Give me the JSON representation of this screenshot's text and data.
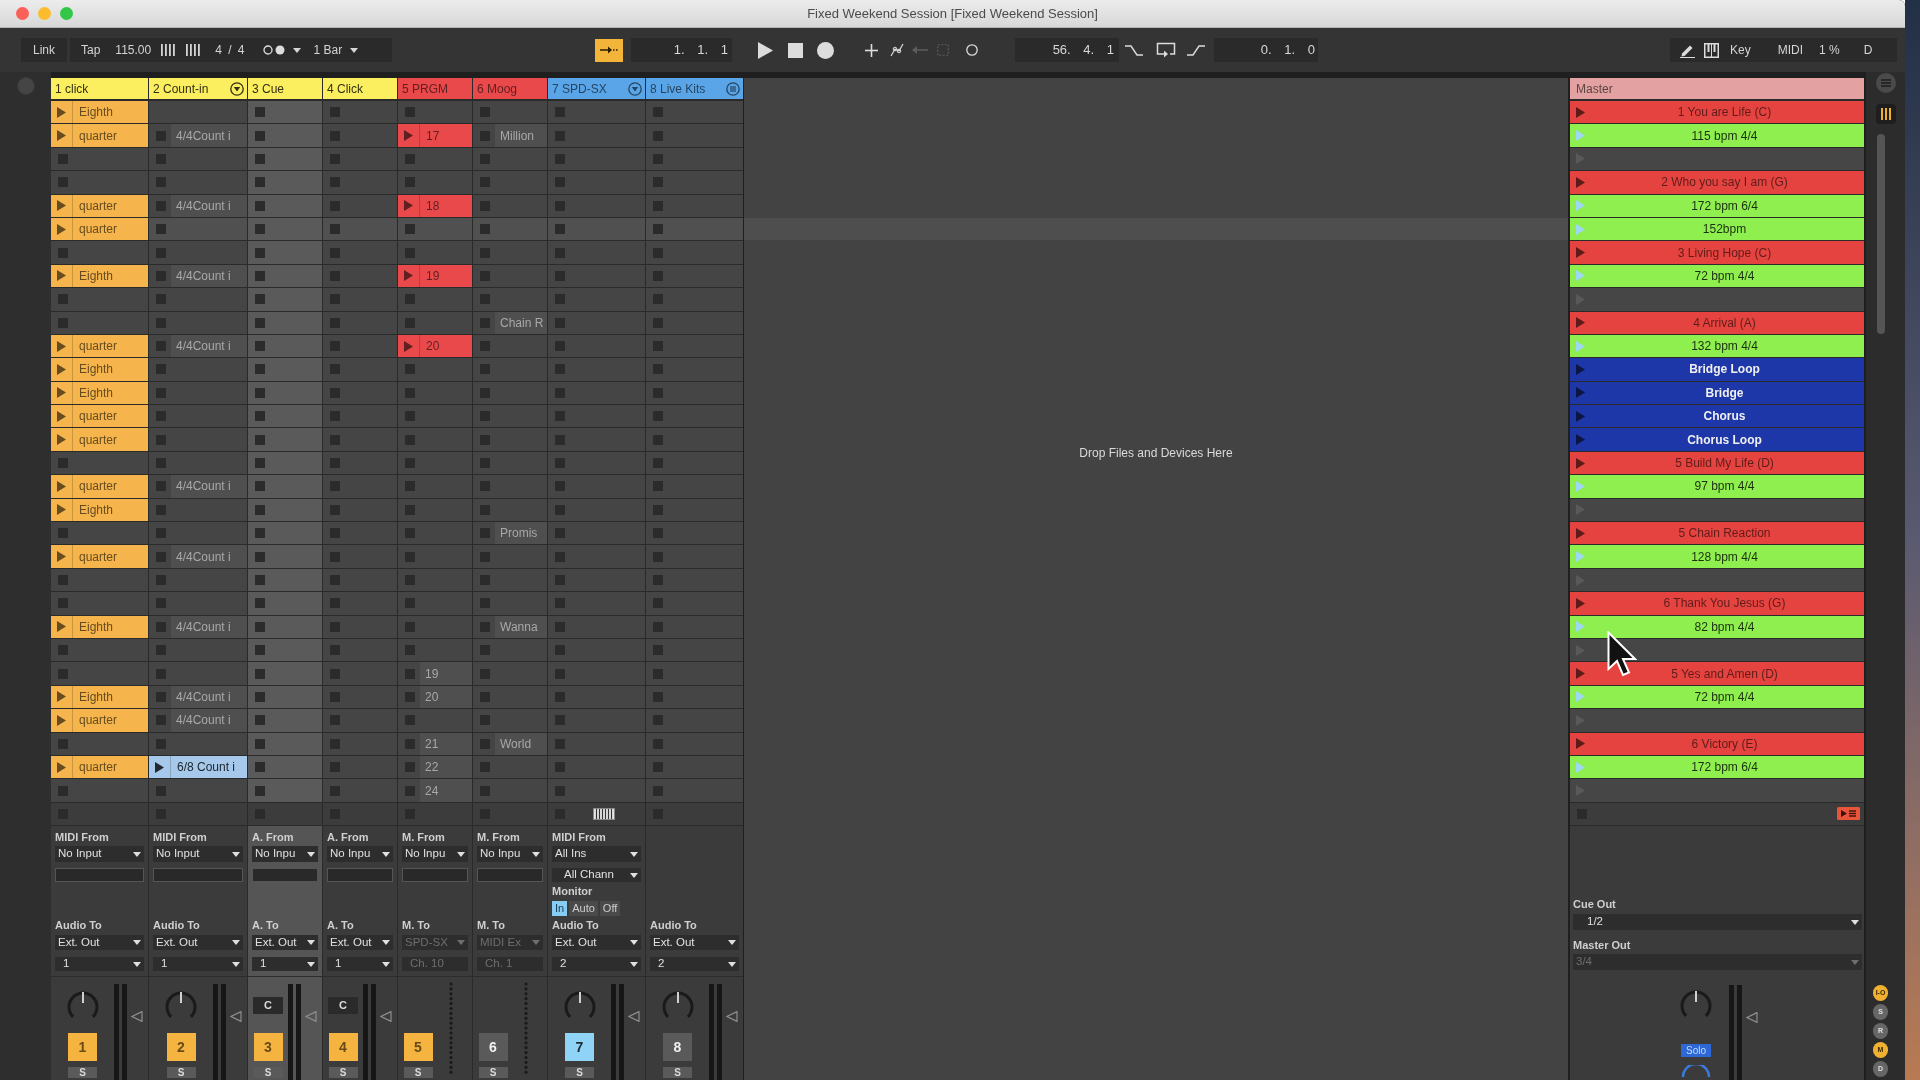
{
  "window": {
    "title": "Fixed Weekend Session [Fixed Weekend Session]"
  },
  "toolbar": {
    "link": "Link",
    "tap": "Tap",
    "tempo": "115.00",
    "signature": "4 / 4",
    "quantization": "1 Bar",
    "follow": {
      "on": true
    },
    "position": "1. 1. 1",
    "loop_start": "56. 4. 1",
    "loop_length": "0. 1. 0",
    "key": "Key",
    "midi": "MIDI",
    "cpu": "1 %",
    "disk": "D"
  },
  "tracks": [
    {
      "name": "1 click",
      "color": "#fbee5f",
      "kind": "plain",
      "selected": false,
      "keys": false,
      "slots": [
        {
          "kind": "clip",
          "name": "Eighth",
          "color": "#f5b54c"
        },
        {
          "kind": "clip",
          "name": "quarter",
          "color": "#f5b54c"
        },
        {
          "kind": "empty"
        },
        {
          "kind": "empty"
        },
        {
          "kind": "clip",
          "name": "quarter",
          "color": "#f5b54c"
        },
        {
          "kind": "clip",
          "name": "quarter",
          "color": "#f5b54c"
        },
        {
          "kind": "empty"
        },
        {
          "kind": "clip",
          "name": "Eighth",
          "color": "#f5b54c"
        },
        {
          "kind": "empty"
        },
        {
          "kind": "empty"
        },
        {
          "kind": "clip",
          "name": "quarter",
          "color": "#f5b54c"
        },
        {
          "kind": "clip",
          "name": "Eighth",
          "color": "#f5b54c"
        },
        {
          "kind": "clip",
          "name": "Eighth",
          "color": "#f5b54c"
        },
        {
          "kind": "clip",
          "name": "quarter",
          "color": "#f5b54c"
        },
        {
          "kind": "clip",
          "name": "quarter",
          "color": "#f5b54c"
        },
        {
          "kind": "empty"
        },
        {
          "kind": "clip",
          "name": "quarter",
          "color": "#f5b54c"
        },
        {
          "kind": "clip",
          "name": "Eighth",
          "color": "#f5b54c"
        },
        {
          "kind": "empty"
        },
        {
          "kind": "clip",
          "name": "quarter",
          "color": "#f5b54c"
        },
        {
          "kind": "empty"
        },
        {
          "kind": "empty"
        },
        {
          "kind": "clip",
          "name": "Eighth",
          "color": "#f5b54c"
        },
        {
          "kind": "empty"
        },
        {
          "kind": "empty"
        },
        {
          "kind": "clip",
          "name": "Eighth",
          "color": "#f5b54c"
        },
        {
          "kind": "clip",
          "name": "quarter",
          "color": "#f5b54c"
        },
        {
          "kind": "empty"
        },
        {
          "kind": "clip",
          "name": "quarter",
          "color": "#f5b54c"
        },
        {
          "kind": "empty"
        }
      ],
      "mixer": {
        "kind": "knob",
        "input_label": "MIDI From",
        "input": "No Input",
        "output_label": "Audio To",
        "output": "Ext. Out",
        "output_disabled": false,
        "channel": "1",
        "activator": {
          "label": "1",
          "color": "#f5b43f"
        },
        "solo": "S"
      }
    },
    {
      "name": "2 Count-in",
      "color": "#fbee5f",
      "kind": "group",
      "selected": false,
      "keys": false,
      "slots": [
        {
          "kind": "blank"
        },
        {
          "kind": "dim",
          "name": "4/4Count i"
        },
        {
          "kind": "empty"
        },
        {
          "kind": "empty"
        },
        {
          "kind": "dim",
          "name": "4/4Count i"
        },
        {
          "kind": "empty"
        },
        {
          "kind": "empty"
        },
        {
          "kind": "dim",
          "name": "4/4Count i"
        },
        {
          "kind": "empty"
        },
        {
          "kind": "empty"
        },
        {
          "kind": "dim",
          "name": "4/4Count i"
        },
        {
          "kind": "empty"
        },
        {
          "kind": "empty"
        },
        {
          "kind": "empty"
        },
        {
          "kind": "empty"
        },
        {
          "kind": "empty"
        },
        {
          "kind": "dim",
          "name": "4/4Count i"
        },
        {
          "kind": "empty"
        },
        {
          "kind": "empty"
        },
        {
          "kind": "dim",
          "name": "4/4Count i"
        },
        {
          "kind": "empty"
        },
        {
          "kind": "empty"
        },
        {
          "kind": "dim",
          "name": "4/4Count i"
        },
        {
          "kind": "empty"
        },
        {
          "kind": "empty"
        },
        {
          "kind": "dim",
          "name": "4/4Count i"
        },
        {
          "kind": "dim",
          "name": "4/4Count i"
        },
        {
          "kind": "empty"
        },
        {
          "kind": "clip",
          "name": "6/8 Count i",
          "color": "#a6c8ea"
        },
        {
          "kind": "empty"
        }
      ],
      "mixer": {
        "kind": "knob",
        "input_label": "MIDI From",
        "input": "No Input",
        "output_label": "Audio To",
        "output": "Ext. Out",
        "output_disabled": false,
        "channel": "1",
        "activator": {
          "label": "2",
          "color": "#f5b43f"
        },
        "solo": "S"
      }
    },
    {
      "name": "3 Cue",
      "color": "#fbee5f",
      "kind": "plain",
      "selected": true,
      "keys": false,
      "slots": [
        {
          "kind": "empty"
        },
        {
          "kind": "empty"
        },
        {
          "kind": "empty"
        },
        {
          "kind": "empty"
        },
        {
          "kind": "empty"
        },
        {
          "kind": "empty"
        },
        {
          "kind": "empty"
        },
        {
          "kind": "empty"
        },
        {
          "kind": "empty"
        },
        {
          "kind": "empty"
        },
        {
          "kind": "empty"
        },
        {
          "kind": "empty"
        },
        {
          "kind": "empty"
        },
        {
          "kind": "empty"
        },
        {
          "kind": "empty"
        },
        {
          "kind": "empty"
        },
        {
          "kind": "empty"
        },
        {
          "kind": "empty"
        },
        {
          "kind": "empty"
        },
        {
          "kind": "empty"
        },
        {
          "kind": "empty"
        },
        {
          "kind": "empty"
        },
        {
          "kind": "empty"
        },
        {
          "kind": "empty"
        },
        {
          "kind": "empty"
        },
        {
          "kind": "empty"
        },
        {
          "kind": "empty"
        },
        {
          "kind": "empty"
        },
        {
          "kind": "empty"
        },
        {
          "kind": "empty"
        }
      ],
      "mixer": {
        "kind": "cue",
        "control_label": "C",
        "input_label": "A. From",
        "input": "No Inpu",
        "output_label": "A. To",
        "output": "Ext. Out",
        "output_disabled": false,
        "channel": "1",
        "activator": {
          "label": "3",
          "color": "#f5b43f"
        },
        "solo": "S"
      }
    },
    {
      "name": "4 Click",
      "color": "#fbee5f",
      "kind": "plain",
      "selected": false,
      "keys": false,
      "slots": [
        {
          "kind": "empty"
        },
        {
          "kind": "empty"
        },
        {
          "kind": "empty"
        },
        {
          "kind": "empty"
        },
        {
          "kind": "empty"
        },
        {
          "kind": "empty"
        },
        {
          "kind": "empty"
        },
        {
          "kind": "empty"
        },
        {
          "kind": "empty"
        },
        {
          "kind": "empty"
        },
        {
          "kind": "empty"
        },
        {
          "kind": "empty"
        },
        {
          "kind": "empty"
        },
        {
          "kind": "empty"
        },
        {
          "kind": "empty"
        },
        {
          "kind": "empty"
        },
        {
          "kind": "empty"
        },
        {
          "kind": "empty"
        },
        {
          "kind": "empty"
        },
        {
          "kind": "empty"
        },
        {
          "kind": "empty"
        },
        {
          "kind": "empty"
        },
        {
          "kind": "empty"
        },
        {
          "kind": "empty"
        },
        {
          "kind": "empty"
        },
        {
          "kind": "empty"
        },
        {
          "kind": "empty"
        },
        {
          "kind": "empty"
        },
        {
          "kind": "empty"
        },
        {
          "kind": "empty"
        }
      ],
      "mixer": {
        "kind": "cue",
        "control_label": "C",
        "input_label": "A. From",
        "input": "No Inpu",
        "output_label": "A. To",
        "output": "Ext. Out",
        "output_disabled": false,
        "channel": "1",
        "activator": {
          "label": "4",
          "color": "#f5b43f"
        },
        "solo": "S"
      }
    },
    {
      "name": "5 PRGM",
      "color": "#e9494b",
      "kind": "plain",
      "selected": false,
      "keys": false,
      "slots": [
        {
          "kind": "empty"
        },
        {
          "kind": "clip",
          "name": "17",
          "color": "#e9494b"
        },
        {
          "kind": "empty"
        },
        {
          "kind": "empty"
        },
        {
          "kind": "clip",
          "name": "18",
          "color": "#e9494b"
        },
        {
          "kind": "empty"
        },
        {
          "kind": "empty"
        },
        {
          "kind": "clip",
          "name": "19",
          "color": "#e9494b"
        },
        {
          "kind": "empty"
        },
        {
          "kind": "empty"
        },
        {
          "kind": "clip",
          "name": "20",
          "color": "#e9494b"
        },
        {
          "kind": "empty"
        },
        {
          "kind": "empty"
        },
        {
          "kind": "empty"
        },
        {
          "kind": "empty"
        },
        {
          "kind": "empty"
        },
        {
          "kind": "empty"
        },
        {
          "kind": "empty"
        },
        {
          "kind": "empty"
        },
        {
          "kind": "empty"
        },
        {
          "kind": "empty"
        },
        {
          "kind": "empty"
        },
        {
          "kind": "empty"
        },
        {
          "kind": "empty"
        },
        {
          "kind": "dim",
          "name": "19"
        },
        {
          "kind": "dim",
          "name": "20"
        },
        {
          "kind": "empty"
        },
        {
          "kind": "dim",
          "name": "21"
        },
        {
          "kind": "dim",
          "name": "22"
        },
        {
          "kind": "dim",
          "name": "24"
        }
      ],
      "mixer": {
        "kind": "midi",
        "input_label": "M. From",
        "input": "No Inpu",
        "output_label": "M. To",
        "output": "SPD-SX",
        "output_disabled": true,
        "channel": "Ch. 10",
        "activator": {
          "label": "5",
          "color": "#f5b43f"
        },
        "solo": "S"
      }
    },
    {
      "name": "6 Moog",
      "color": "#e9494b",
      "kind": "plain",
      "selected": false,
      "keys": false,
      "slots": [
        {
          "kind": "empty"
        },
        {
          "kind": "dim",
          "name": "Million"
        },
        {
          "kind": "empty"
        },
        {
          "kind": "empty"
        },
        {
          "kind": "empty"
        },
        {
          "kind": "empty"
        },
        {
          "kind": "empty"
        },
        {
          "kind": "empty"
        },
        {
          "kind": "empty"
        },
        {
          "kind": "dim",
          "name": "Chain R"
        },
        {
          "kind": "empty"
        },
        {
          "kind": "empty"
        },
        {
          "kind": "empty"
        },
        {
          "kind": "empty"
        },
        {
          "kind": "empty"
        },
        {
          "kind": "empty"
        },
        {
          "kind": "empty"
        },
        {
          "kind": "empty"
        },
        {
          "kind": "dim",
          "name": "Promis"
        },
        {
          "kind": "empty"
        },
        {
          "kind": "empty"
        },
        {
          "kind": "empty"
        },
        {
          "kind": "dim",
          "name": "Wanna"
        },
        {
          "kind": "empty"
        },
        {
          "kind": "empty"
        },
        {
          "kind": "empty"
        },
        {
          "kind": "empty"
        },
        {
          "kind": "dim",
          "name": "World"
        },
        {
          "kind": "empty"
        },
        {
          "kind": "empty"
        }
      ],
      "mixer": {
        "kind": "midi",
        "input_label": "M. From",
        "input": "No Inpu",
        "output_label": "M. To",
        "output": "MIDI Ex",
        "output_disabled": true,
        "channel": "Ch. 1",
        "activator": {
          "label": "6",
          "color": "#5a5a5a"
        },
        "solo": "S"
      }
    },
    {
      "name": "7 SPD-SX",
      "color": "#5aa5e8",
      "kind": "group",
      "selected": false,
      "keys": true,
      "slots": [
        {
          "kind": "empty"
        },
        {
          "kind": "empty"
        },
        {
          "kind": "empty"
        },
        {
          "kind": "empty"
        },
        {
          "kind": "empty"
        },
        {
          "kind": "empty"
        },
        {
          "kind": "empty"
        },
        {
          "kind": "empty"
        },
        {
          "kind": "empty"
        },
        {
          "kind": "empty"
        },
        {
          "kind": "empty"
        },
        {
          "kind": "empty"
        },
        {
          "kind": "empty"
        },
        {
          "kind": "empty"
        },
        {
          "kind": "empty"
        },
        {
          "kind": "empty"
        },
        {
          "kind": "empty"
        },
        {
          "kind": "empty"
        },
        {
          "kind": "empty"
        },
        {
          "kind": "empty"
        },
        {
          "kind": "empty"
        },
        {
          "kind": "empty"
        },
        {
          "kind": "empty"
        },
        {
          "kind": "empty"
        },
        {
          "kind": "empty"
        },
        {
          "kind": "empty"
        },
        {
          "kind": "empty"
        },
        {
          "kind": "empty"
        },
        {
          "kind": "empty"
        },
        {
          "kind": "empty"
        }
      ],
      "mixer": {
        "kind": "knob",
        "input_label": "MIDI From",
        "input": "All Ins",
        "input_channel": "All Chann",
        "monitor": {
          "label": "Monitor",
          "options": [
            {
              "label": "In",
              "selected": true
            },
            {
              "label": "Auto",
              "selected": false
            },
            {
              "label": "Off",
              "selected": false
            }
          ]
        },
        "output_label": "Audio To",
        "output": "Ext. Out",
        "output_disabled": false,
        "channel": "2",
        "activator": {
          "label": "7",
          "color": "#8fd3f7"
        },
        "solo": "S"
      }
    },
    {
      "name": "8 Live Kits",
      "color": "#5aa5e8",
      "kind": "menu",
      "selected": false,
      "keys": false,
      "slots": [
        {
          "kind": "empty"
        },
        {
          "kind": "empty"
        },
        {
          "kind": "empty"
        },
        {
          "kind": "empty"
        },
        {
          "kind": "empty"
        },
        {
          "kind": "empty"
        },
        {
          "kind": "empty"
        },
        {
          "kind": "empty"
        },
        {
          "kind": "empty"
        },
        {
          "kind": "empty"
        },
        {
          "kind": "empty"
        },
        {
          "kind": "empty"
        },
        {
          "kind": "empty"
        },
        {
          "kind": "empty"
        },
        {
          "kind": "empty"
        },
        {
          "kind": "empty"
        },
        {
          "kind": "empty"
        },
        {
          "kind": "empty"
        },
        {
          "kind": "empty"
        },
        {
          "kind": "empty"
        },
        {
          "kind": "empty"
        },
        {
          "kind": "empty"
        },
        {
          "kind": "empty"
        },
        {
          "kind": "empty"
        },
        {
          "kind": "empty"
        },
        {
          "kind": "empty"
        },
        {
          "kind": "empty"
        },
        {
          "kind": "empty"
        },
        {
          "kind": "empty"
        },
        {
          "kind": "empty"
        }
      ],
      "mixer": {
        "kind": "knob",
        "output_label": "Audio To",
        "output": "Ext. Out",
        "output_disabled": false,
        "channel": "2",
        "activator": {
          "label": "8",
          "color": "#5a5a5a"
        },
        "solo": "S"
      }
    }
  ],
  "drop_hint": "Drop Files and Devices Here",
  "master": {
    "name": "Master",
    "color": "#e3a1a1",
    "scenes": [
      {
        "kind": "song",
        "name": "1 You are Life (C)",
        "color": "#e5433f",
        "selected": false
      },
      {
        "kind": "tempo",
        "name": "115 bpm 4/4",
        "color": "#8eef4f",
        "selected": false
      },
      {
        "kind": "empty",
        "selected": false
      },
      {
        "kind": "song",
        "name": "2 Who you say I am (G)",
        "color": "#e5433f",
        "selected": false
      },
      {
        "kind": "tempo",
        "name": "172 bpm 6/4",
        "color": "#8eef4f",
        "selected": false
      },
      {
        "kind": "tempo",
        "name": "152bpm",
        "color": "#8eef4f",
        "selected": true
      },
      {
        "kind": "song",
        "name": "3 Living Hope (C)",
        "color": "#e5433f",
        "selected": false
      },
      {
        "kind": "tempo",
        "name": "72 bpm 4/4",
        "color": "#8eef4f",
        "selected": false
      },
      {
        "kind": "empty",
        "selected": false
      },
      {
        "kind": "song",
        "name": "4 Arrival (A)",
        "color": "#e5433f",
        "selected": false
      },
      {
        "kind": "tempo",
        "name": "132 bpm 4/4",
        "color": "#8eef4f",
        "selected": false
      },
      {
        "kind": "section",
        "name": "Bridge Loop",
        "color": "#1d36a8",
        "selected": false
      },
      {
        "kind": "section",
        "name": "Bridge",
        "color": "#1d36a8",
        "selected": false
      },
      {
        "kind": "section",
        "name": "Chorus",
        "color": "#1d36a8",
        "selected": false
      },
      {
        "kind": "section",
        "name": "Chorus Loop",
        "color": "#1d36a8",
        "selected": false
      },
      {
        "kind": "song",
        "name": "5 Build My Life (D)",
        "color": "#e5433f",
        "selected": false
      },
      {
        "kind": "tempo",
        "name": "97 bpm 4/4",
        "color": "#8eef4f",
        "selected": false
      },
      {
        "kind": "empty",
        "selected": false
      },
      {
        "kind": "song",
        "name": "5 Chain Reaction",
        "color": "#e5433f",
        "selected": false
      },
      {
        "kind": "tempo",
        "name": "128 bpm 4/4",
        "color": "#8eef4f",
        "selected": false
      },
      {
        "kind": "empty",
        "selected": false
      },
      {
        "kind": "song",
        "name": "6 Thank You Jesus (G)",
        "color": "#e5433f",
        "selected": false
      },
      {
        "kind": "tempo",
        "name": "82 bpm 4/4",
        "color": "#8eef4f",
        "selected": false
      },
      {
        "kind": "empty",
        "selected": false
      },
      {
        "kind": "song",
        "name": "5 Yes and Amen (D)",
        "color": "#e5433f",
        "selected": false
      },
      {
        "kind": "tempo",
        "name": "72 bpm 4/4",
        "color": "#8eef4f",
        "selected": false
      },
      {
        "kind": "empty",
        "selected": false
      },
      {
        "kind": "song",
        "name": "6 Victory (E)",
        "color": "#e5433f",
        "selected": false
      },
      {
        "kind": "tempo",
        "name": "172 bpm 6/4",
        "color": "#8eef4f",
        "selected": false
      },
      {
        "kind": "empty",
        "selected": false
      }
    ],
    "cue_out_label": "Cue Out",
    "cue_out": "1/2",
    "master_out_label": "Master Out",
    "master_out": "3/4",
    "master_out_disabled": true,
    "solo": {
      "label": "Solo",
      "on": true
    }
  },
  "view_buttons": [
    {
      "label": "I-O",
      "on": true
    },
    {
      "label": "S",
      "on": false
    },
    {
      "label": "R",
      "on": false
    },
    {
      "label": "M",
      "on": true
    },
    {
      "label": "D",
      "on": false
    }
  ]
}
